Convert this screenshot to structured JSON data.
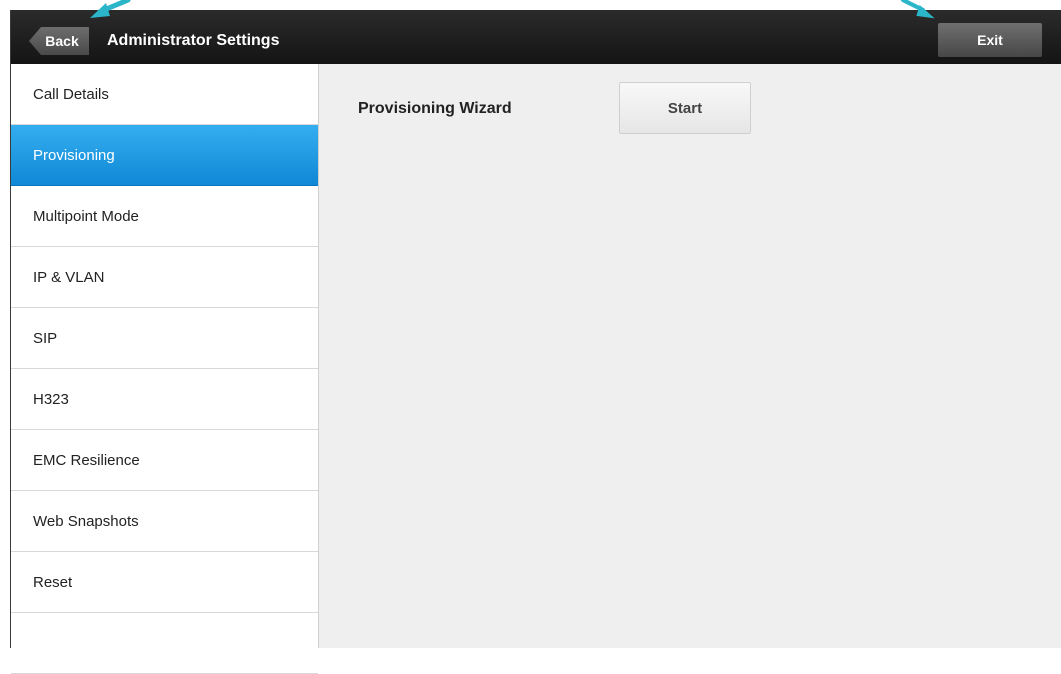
{
  "header": {
    "back_label": "Back",
    "title": "Administrator Settings",
    "exit_label": "Exit"
  },
  "sidebar": {
    "items": [
      {
        "label": "Call Details",
        "selected": false
      },
      {
        "label": "Provisioning",
        "selected": true
      },
      {
        "label": "Multipoint Mode",
        "selected": false
      },
      {
        "label": "IP & VLAN",
        "selected": false
      },
      {
        "label": "SIP",
        "selected": false
      },
      {
        "label": "H323",
        "selected": false
      },
      {
        "label": "EMC Resilience",
        "selected": false
      },
      {
        "label": "Web Snapshots",
        "selected": false
      },
      {
        "label": "Reset",
        "selected": false
      },
      {
        "label": "",
        "selected": false
      }
    ]
  },
  "main": {
    "wizard_label": "Provisioning Wizard",
    "start_label": "Start"
  },
  "colors": {
    "accent": "#1a9be6",
    "callout": "#2bb5c9"
  }
}
